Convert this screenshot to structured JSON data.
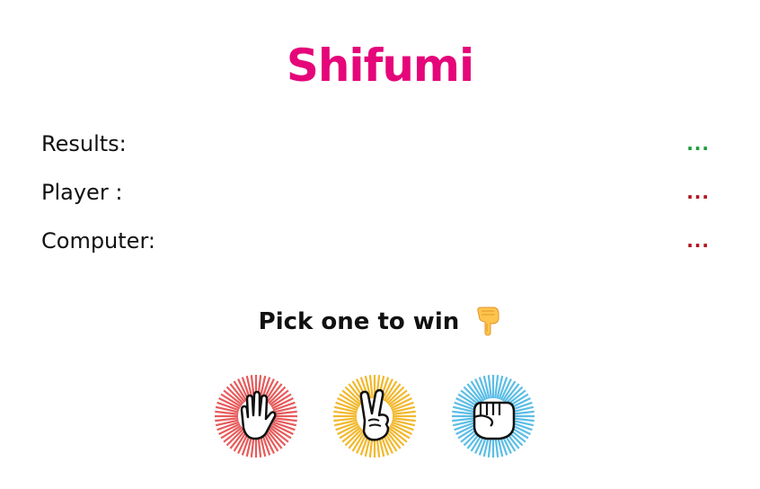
{
  "app": {
    "title": "Shifumi"
  },
  "stats": {
    "results": {
      "label": "Results:",
      "value": "...",
      "color": "#1a9c3c"
    },
    "player": {
      "label": "Player :",
      "value": "...",
      "color": "#b3121d"
    },
    "computer": {
      "label": "Computer:",
      "value": "...",
      "color": "#b3121d"
    }
  },
  "prompt": {
    "text": "Pick one to win",
    "icon": "pointing-down-hand-icon"
  },
  "choices": [
    {
      "icon": "paper-hand-icon",
      "ring_color": "#e65b5b"
    },
    {
      "icon": "scissors-hand-icon",
      "ring_color": "#f2b82c"
    },
    {
      "icon": "rock-fist-icon",
      "ring_color": "#5bbde6"
    }
  ]
}
